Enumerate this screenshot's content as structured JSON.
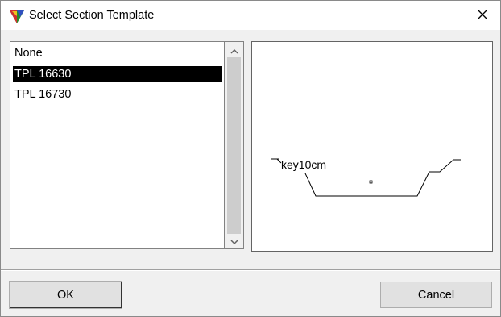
{
  "window": {
    "title": "Select Section Template"
  },
  "template_list": {
    "items": [
      {
        "label": "None",
        "selected": false
      },
      {
        "label": "TPL 16630",
        "selected": true
      },
      {
        "label": "TPL 16730",
        "selected": false
      }
    ]
  },
  "preview": {
    "label": "key10cm"
  },
  "buttons": {
    "ok_label": "OK",
    "cancel_label": "Cancel"
  },
  "icons": {
    "app": "app-triangle-icon",
    "close": "close-icon",
    "scroll_up": "chevron-up-icon",
    "scroll_down": "chevron-down-icon"
  },
  "colors": {
    "selection_bg": "#000000",
    "selection_fg": "#ffffff"
  }
}
